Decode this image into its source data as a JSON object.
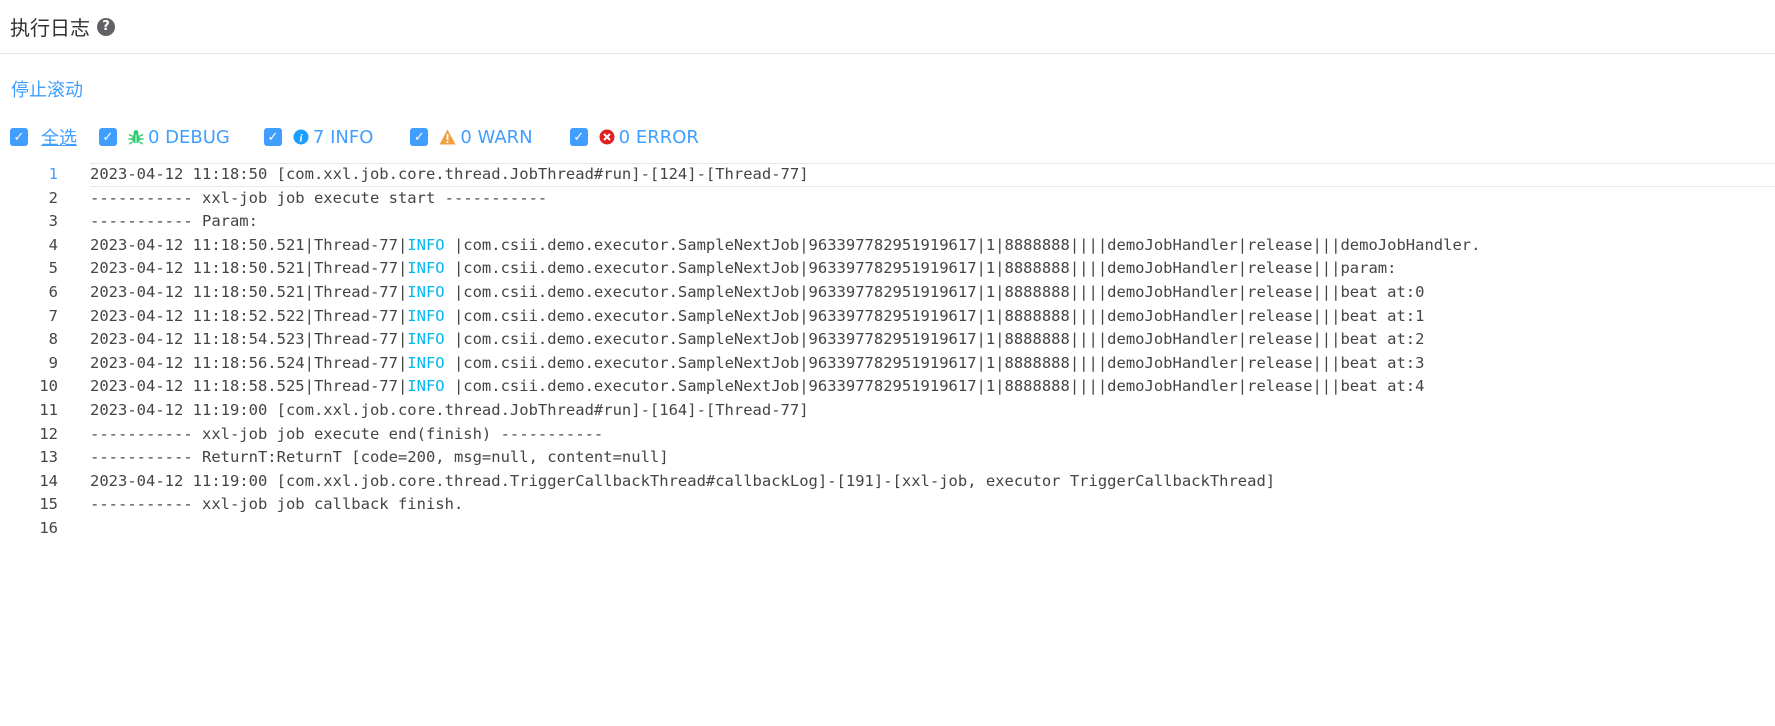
{
  "header": {
    "title": "执行日志",
    "help_icon": "question-circle-icon"
  },
  "toolbar": {
    "stop_scroll_label": "停止滚动"
  },
  "filters": {
    "select_all": {
      "label": "全选",
      "checked": true
    },
    "levels": [
      {
        "key": "debug",
        "label": "0 DEBUG",
        "checked": true,
        "icon": "bug-icon",
        "color": "#2ecc71"
      },
      {
        "key": "info",
        "label": "7 INFO",
        "checked": true,
        "icon": "info-circle-icon",
        "color": "#1e9fff"
      },
      {
        "key": "warn",
        "label": "0 WARN",
        "checked": true,
        "icon": "warning-triangle-icon",
        "color": "#f0a040"
      },
      {
        "key": "error",
        "label": "0 ERROR",
        "checked": true,
        "icon": "error-circle-icon",
        "color": "#e02020"
      }
    ]
  },
  "log": {
    "lines": [
      {
        "n": "1",
        "pre": "2023-04-12 11:18:50 [com.xxl.job.core.thread.JobThread#run]-[124]-[Thread-77]",
        "tag": "",
        "post": ""
      },
      {
        "n": "2",
        "pre": "----------- xxl-job job execute start -----------",
        "tag": "",
        "post": ""
      },
      {
        "n": "3",
        "pre": "----------- Param:",
        "tag": "",
        "post": ""
      },
      {
        "n": "4",
        "pre": "2023-04-12 11:18:50.521|Thread-77|",
        "tag": "INFO",
        "post": " |com.csii.demo.executor.SampleNextJob|963397782951919617|1|8888888||||demoJobHandler|release|||demoJobHandler."
      },
      {
        "n": "5",
        "pre": "2023-04-12 11:18:50.521|Thread-77|",
        "tag": "INFO",
        "post": " |com.csii.demo.executor.SampleNextJob|963397782951919617|1|8888888||||demoJobHandler|release|||param:"
      },
      {
        "n": "6",
        "pre": "2023-04-12 11:18:50.521|Thread-77|",
        "tag": "INFO",
        "post": " |com.csii.demo.executor.SampleNextJob|963397782951919617|1|8888888||||demoJobHandler|release|||beat at:0"
      },
      {
        "n": "7",
        "pre": "2023-04-12 11:18:52.522|Thread-77|",
        "tag": "INFO",
        "post": " |com.csii.demo.executor.SampleNextJob|963397782951919617|1|8888888||||demoJobHandler|release|||beat at:1"
      },
      {
        "n": "8",
        "pre": "2023-04-12 11:18:54.523|Thread-77|",
        "tag": "INFO",
        "post": " |com.csii.demo.executor.SampleNextJob|963397782951919617|1|8888888||||demoJobHandler|release|||beat at:2"
      },
      {
        "n": "9",
        "pre": "2023-04-12 11:18:56.524|Thread-77|",
        "tag": "INFO",
        "post": " |com.csii.demo.executor.SampleNextJob|963397782951919617|1|8888888||||demoJobHandler|release|||beat at:3"
      },
      {
        "n": "10",
        "pre": "2023-04-12 11:18:58.525|Thread-77|",
        "tag": "INFO",
        "post": " |com.csii.demo.executor.SampleNextJob|963397782951919617|1|8888888||||demoJobHandler|release|||beat at:4"
      },
      {
        "n": "11",
        "pre": "2023-04-12 11:19:00 [com.xxl.job.core.thread.JobThread#run]-[164]-[Thread-77]",
        "tag": "",
        "post": ""
      },
      {
        "n": "12",
        "pre": "----------- xxl-job job execute end(finish) -----------",
        "tag": "",
        "post": ""
      },
      {
        "n": "13",
        "pre": "----------- ReturnT:ReturnT [code=200, msg=null, content=null]",
        "tag": "",
        "post": ""
      },
      {
        "n": "14",
        "pre": "2023-04-12 11:19:00 [com.xxl.job.core.thread.TriggerCallbackThread#callbackLog]-[191]-[xxl-job, executor TriggerCallbackThread]",
        "tag": "",
        "post": ""
      },
      {
        "n": "15",
        "pre": "----------- xxl-job job callback finish.",
        "tag": "",
        "post": ""
      },
      {
        "n": "16",
        "pre": "",
        "tag": "",
        "post": ""
      }
    ]
  }
}
